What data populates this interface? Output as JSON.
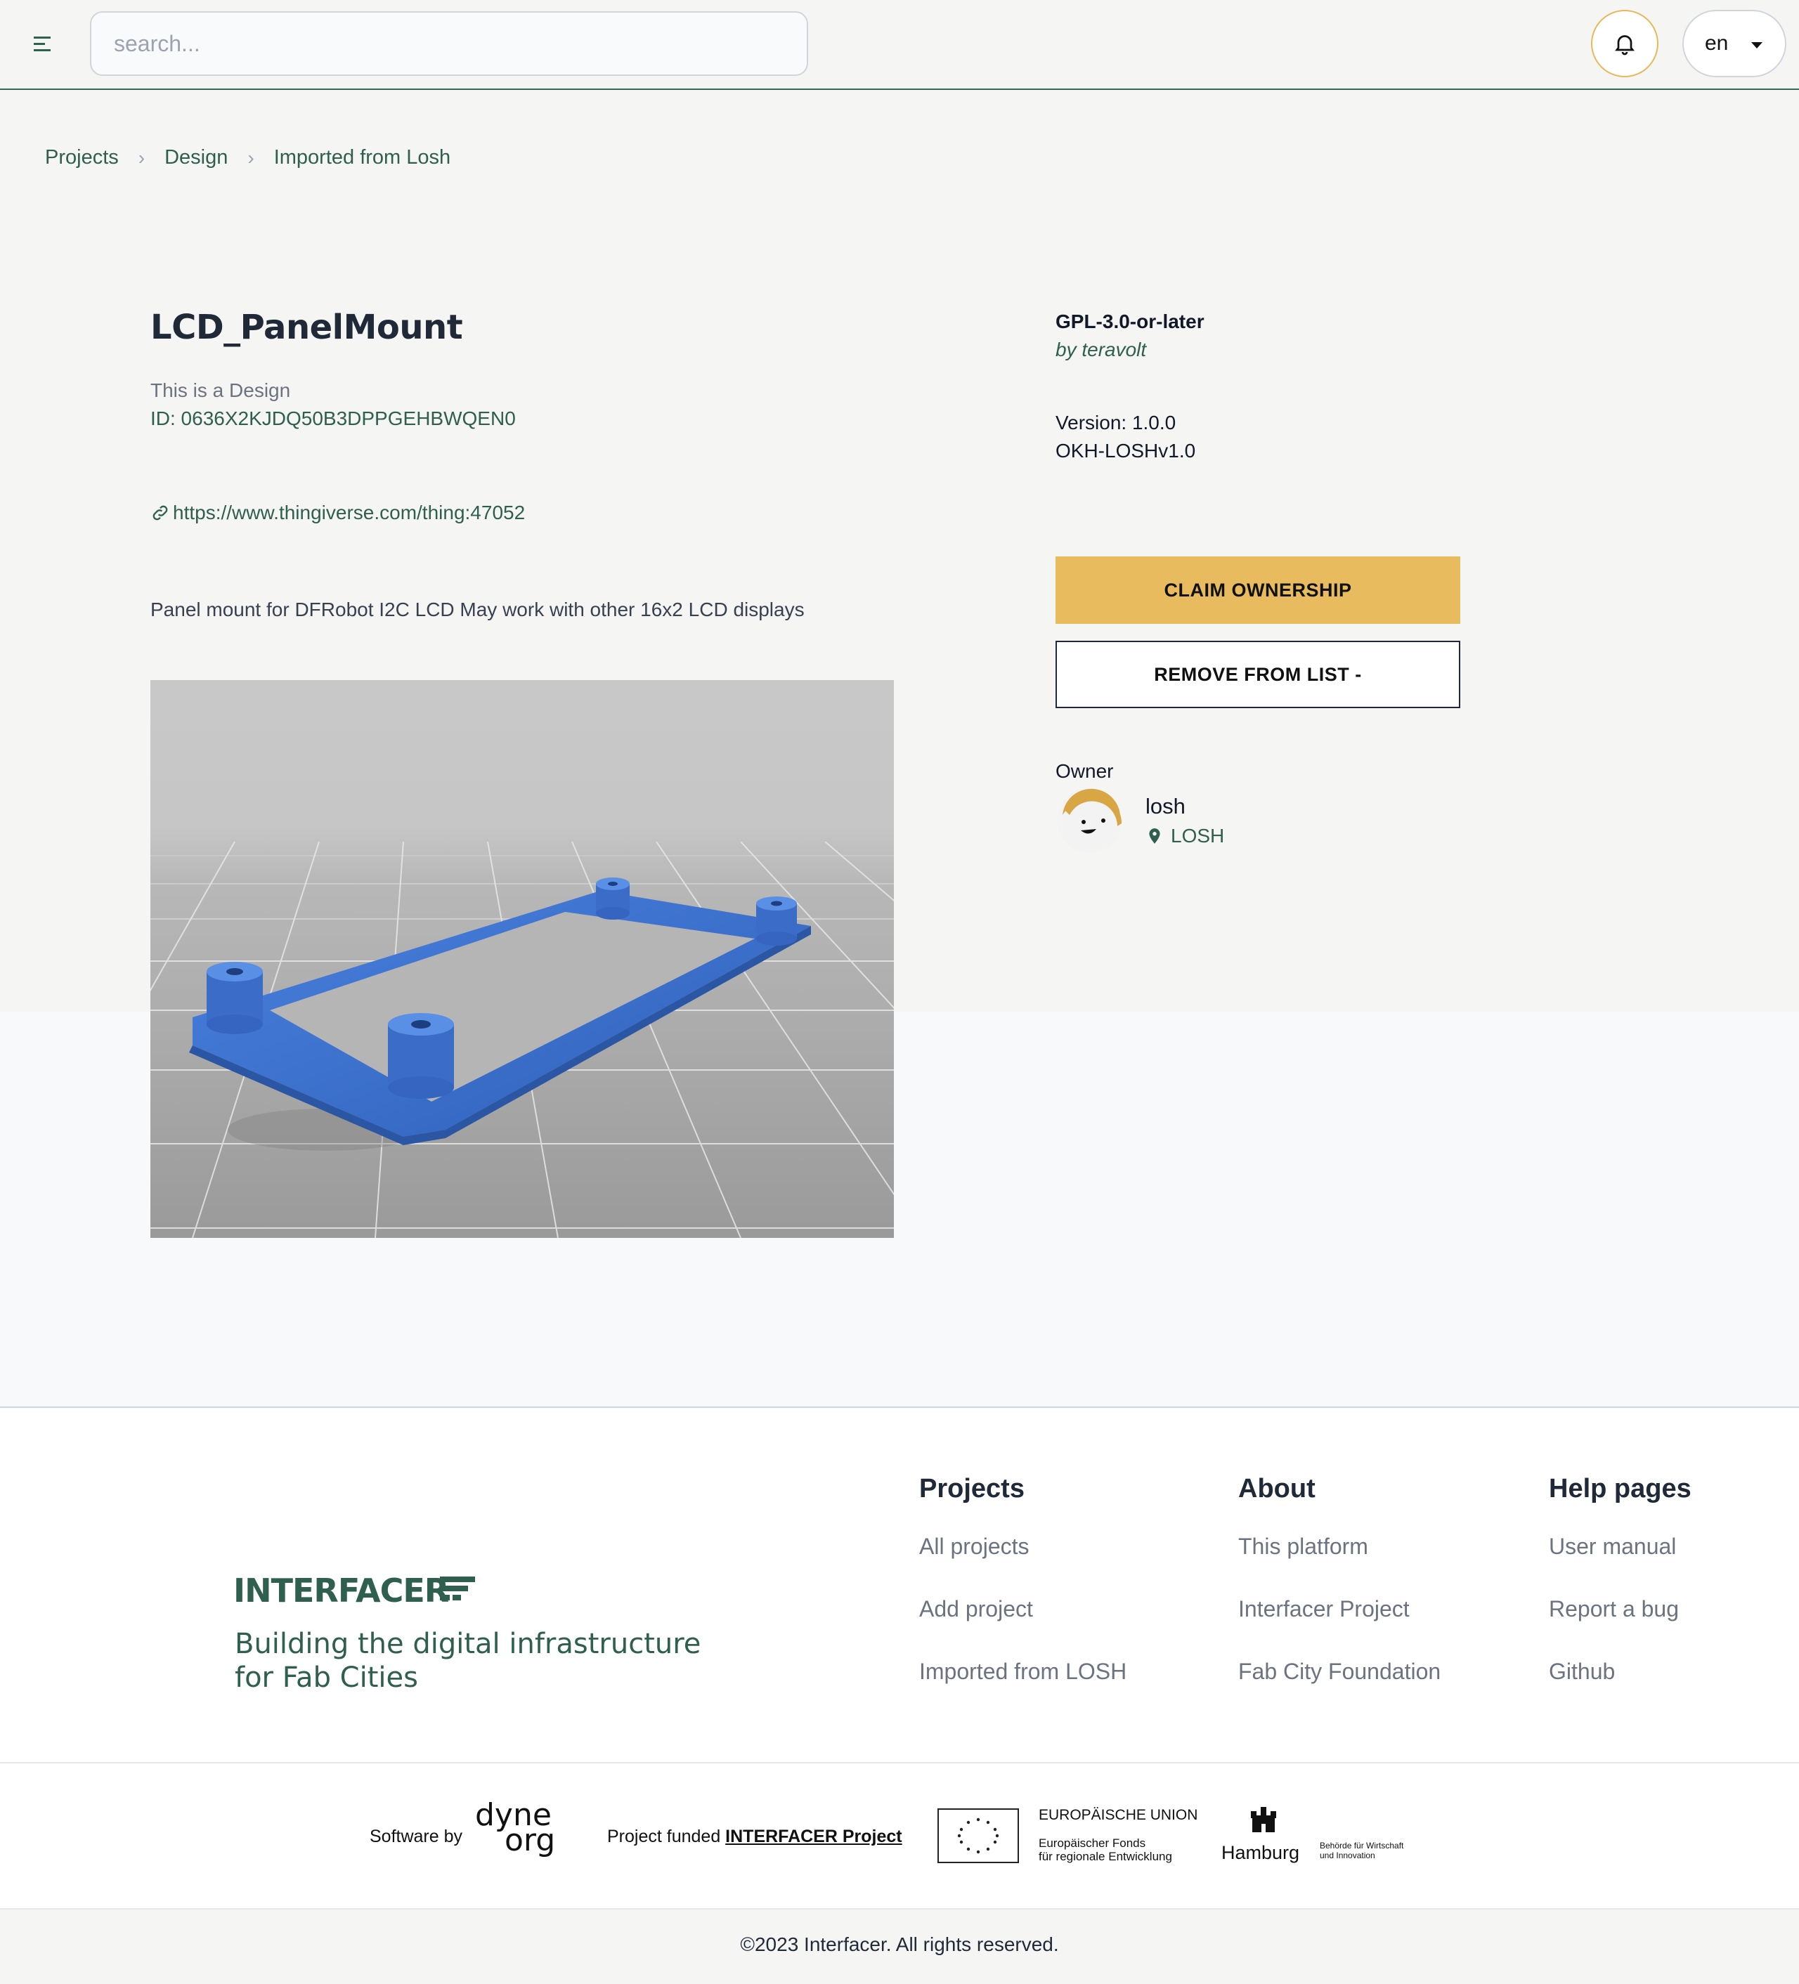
{
  "header": {
    "search_placeholder": "search...",
    "language": "en"
  },
  "breadcrumb": [
    "Projects",
    "Design",
    "Imported from Losh"
  ],
  "project": {
    "title": "LCD_PanelMount",
    "type_text": "This is a Design",
    "id_text": "ID: 0636X2KJDQ50B3DPPGEHBWQEN0",
    "link": "https://www.thingiverse.com/thing:47052",
    "description": "Panel mount for DFRobot I2C LCD May work with other 16x2 LCD displays"
  },
  "side": {
    "license": "GPL-3.0-or-later",
    "author": "by teravolt",
    "version": "Version: 1.0.0",
    "spec": "OKH-LOSHv1.0",
    "claim_button": "CLAIM OWNERSHIP",
    "remove_button": "REMOVE FROM LIST -",
    "owner_label": "Owner",
    "owner_name": "losh",
    "owner_location": "LOSH"
  },
  "footer": {
    "brand": "INTERFACER",
    "tagline_line1": "Building the digital infrastructure",
    "tagline_line2": "for Fab Cities",
    "columns": [
      {
        "heading": "Projects",
        "items": [
          "All projects",
          "Add project",
          "Imported from LOSH"
        ]
      },
      {
        "heading": "About",
        "items": [
          "This platform",
          "Interfacer Project",
          "Fab City Foundation"
        ]
      },
      {
        "heading": "Help pages",
        "items": [
          "User manual",
          "Report a bug",
          "Github"
        ]
      }
    ],
    "software_by": "Software by",
    "dyne_line1": "dyne",
    "dyne_line2": "org",
    "funded_text": "Project funded",
    "funded_link": "INTERFACER Project",
    "eu_title": "EUROPÄISCHE UNION",
    "eu_line1": "Europäischer Fonds",
    "eu_line2": "für regionale Entwicklung",
    "hamburg": "Hamburg",
    "hamburg_line1": "Behörde für Wirtschaft",
    "hamburg_line2": "und Innovation",
    "copyright": "©2023 Interfacer. All rights reserved."
  },
  "colors": {
    "accent_green": "#2f5f4f",
    "claim_yellow": "#e8bc5e",
    "model_blue": "#3d72d4"
  }
}
